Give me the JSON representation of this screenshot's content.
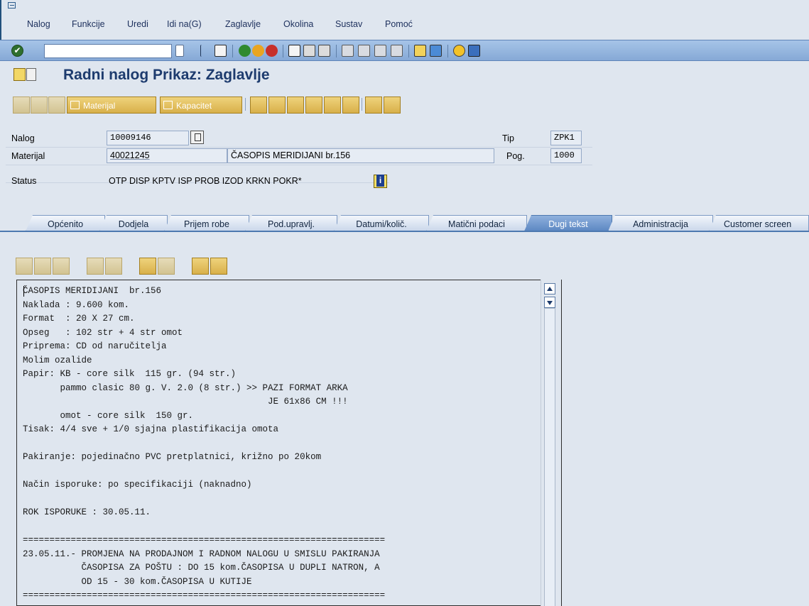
{
  "menu": {
    "items": [
      "Nalog",
      "Funkcije",
      "Uredi",
      "Idi na(G)",
      "Zaglavlje",
      "Okolina",
      "Sustav",
      "Pomoć"
    ]
  },
  "toolbar": {
    "ok_label": "✔",
    "command_value": ""
  },
  "title": "Radni nalog Prikaz: Zaglavlje",
  "app_toolbar": {
    "material_label": "Materijal",
    "capacity_label": "Kapacitet"
  },
  "header": {
    "order_label": "Nalog",
    "order_value": "10009146",
    "material_label": "Materijal",
    "material_value": "40021245",
    "material_desc": "ČASOPIS MERIDIJANI br.156",
    "status_label": "Status",
    "status_value": "OTP  DISP KPTV ISP  PROB IZOD KRKN POKR*",
    "type_label": "Tip",
    "type_value": "ZPK1",
    "plant_label": "Pog.",
    "plant_value": "1000"
  },
  "tabs": [
    {
      "label": "Općenito",
      "active": false
    },
    {
      "label": "Dodjela",
      "active": false
    },
    {
      "label": "Prijem robe",
      "active": false
    },
    {
      "label": "Pod.upravlj.",
      "active": false
    },
    {
      "label": "Datumi/količ.",
      "active": false
    },
    {
      "label": "Matični podaci",
      "active": false
    },
    {
      "label": "Dugi tekst",
      "active": true
    },
    {
      "label": "Administracija",
      "active": false
    },
    {
      "label": "Customer screen",
      "active": false
    }
  ],
  "long_text": "ČASOPIS MERIDIJANI  br.156\nNaklada : 9.600 kom.\nFormat  : 20 X 27 cm.\nOpseg   : 102 str + 4 str omot\nPriprema: CD od naručitelja\nMolim ozalide\nPapir: KB - core silk  115 gr. (94 str.)\n       pammo clasic 80 g. V. 2.0 (8 str.) >> PAZI FORMAT ARKA\n                                              JE 61x86 CM !!!\n       omot - core silk  150 gr.\nTisak: 4/4 sve + 1/0 sjajna plastifikacija omota\n\nPakiranje: pojedinačno PVC pretplatnici, križno po 20kom\n\nNačin isporuke: po specifikaciji (naknadno)\n\nROK ISPORUKE : 30.05.11.\n\n====================================================================\n23.05.11.- PROMJENA NA PRODAJNOM I RADNOM NALOGU U SMISLU PAKIRANJA\n           ČASOPISA ZA POŠTU : DO 15 kom.ČASOPISA U DUPLI NATRON, A\n           OD 15 - 30 kom.ČASOPISA U KUTIJE\n====================================================================",
  "colors": {
    "background": "#dfe6ef",
    "toolbar": "#a6c4e8",
    "title": "#1d3b6e",
    "active_tab": "#5b86c2",
    "button_gold": "#d8b04a"
  },
  "icons": {
    "standard_toolbar": [
      "enter-icon",
      "save-icon",
      "back-icon",
      "exit-icon",
      "cancel-icon",
      "print-icon",
      "find-icon",
      "find-next-icon",
      "first-page-icon",
      "previous-page-icon",
      "next-page-icon",
      "last-page-icon",
      "new-session-icon",
      "shortcut-icon",
      "help-icon",
      "layout-menu-icon"
    ],
    "editor_toolbar": [
      "cut-icon",
      "copy-icon",
      "paste-icon",
      "undo-icon",
      "redo-icon",
      "find-icon",
      "find-next-icon",
      "import-icon",
      "export-icon"
    ]
  }
}
